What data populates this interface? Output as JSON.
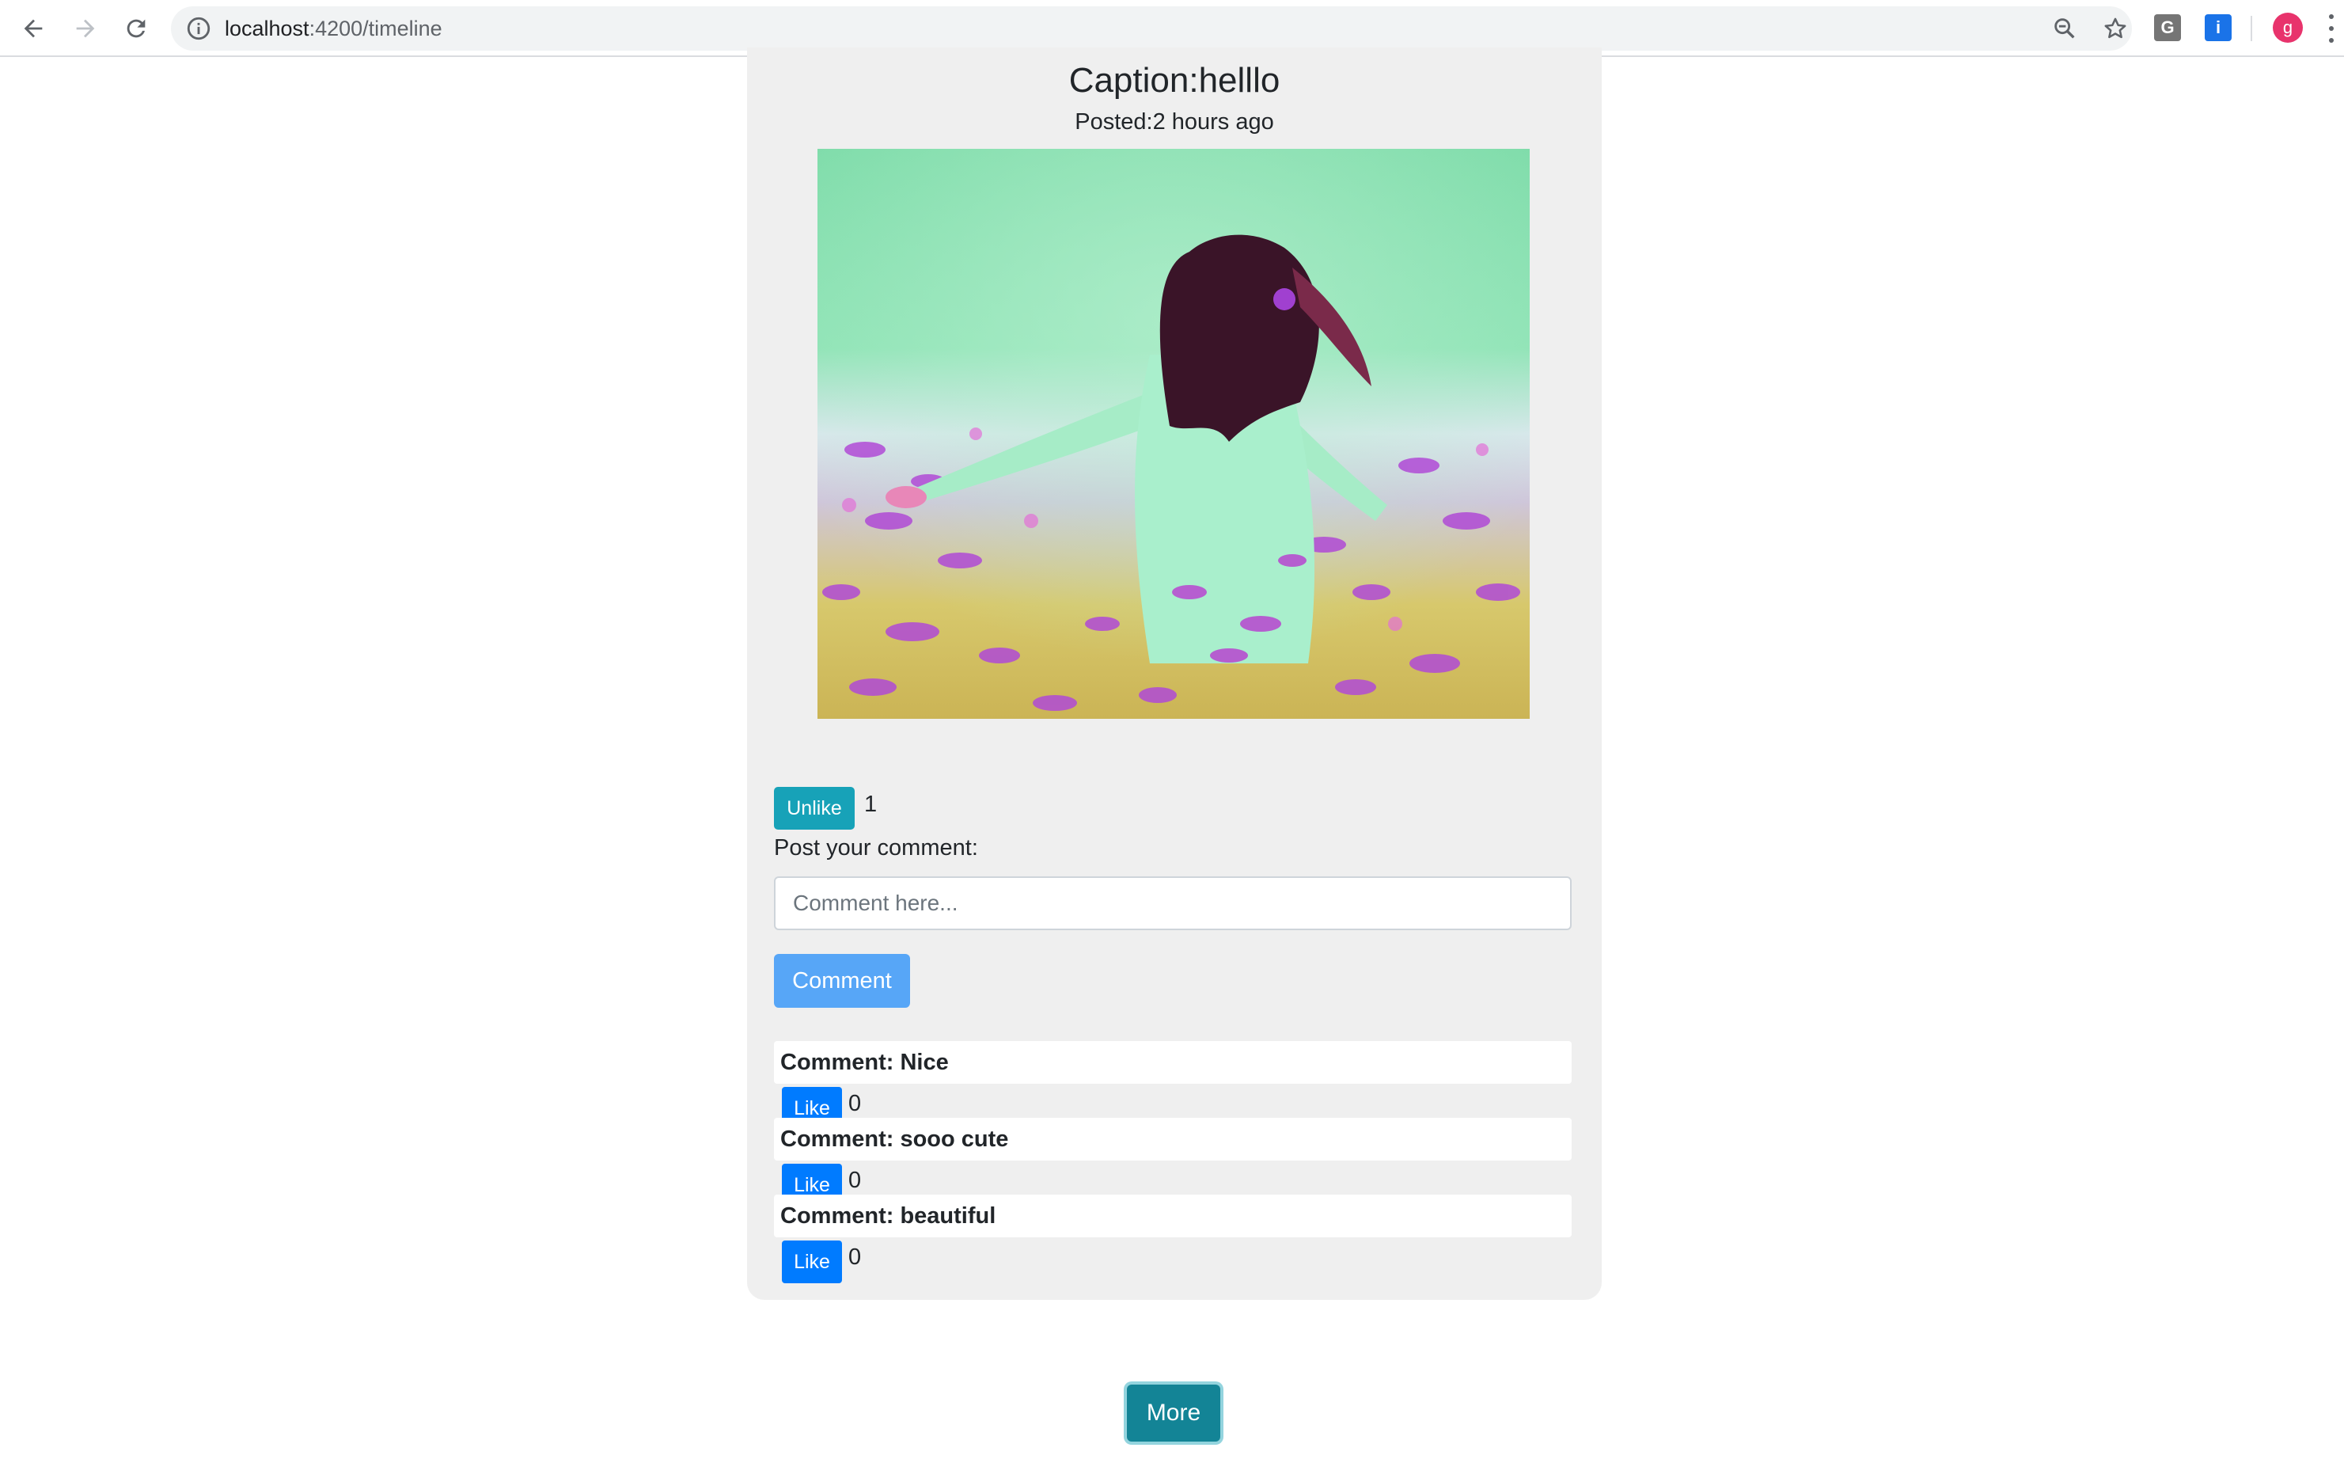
{
  "browser": {
    "url_host": "localhost",
    "url_path": ":4200/timeline",
    "extensions": [
      "G",
      "i"
    ],
    "profile_initial": "g"
  },
  "post": {
    "caption": "Caption:helllo",
    "posted": "Posted:2 hours ago",
    "unlike_label": "Unlike",
    "like_count": "1",
    "comment_prompt": "Post your comment:",
    "comment_placeholder": "Comment here...",
    "comment_button": "Comment",
    "comments": [
      {
        "text": "Comment: Nice",
        "like_label": "Like",
        "likes": "0"
      },
      {
        "text": "Comment: sooo cute",
        "like_label": "Like",
        "likes": "0"
      },
      {
        "text": "Comment: beautiful",
        "like_label": "Like",
        "likes": "0"
      }
    ]
  },
  "more_label": "More",
  "colors": {
    "unlike": "#17a2b8",
    "like": "#007bff",
    "comment_button": "#57a6f7",
    "more": "#138496",
    "card_bg": "#efefef"
  }
}
